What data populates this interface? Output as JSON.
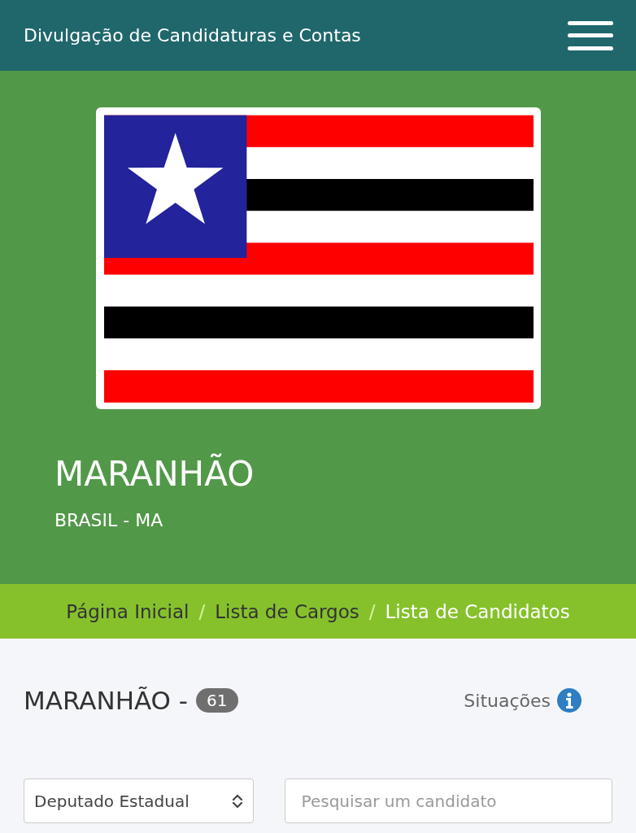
{
  "header": {
    "title": "Divulgação de Candidaturas e Contas"
  },
  "hero": {
    "kind": "flag",
    "title": "MARANHÃO",
    "subtitle": "BRASIL - MA"
  },
  "breadcrumb": {
    "separator": "/",
    "items": [
      {
        "label": "Página Inicial",
        "selected": false
      },
      {
        "label": "Lista de Cargos",
        "selected": false
      },
      {
        "label": "Lista de Candidatos",
        "selected": true
      }
    ]
  },
  "heading": {
    "title": "MARANHÃO -",
    "count": "61",
    "info_label": "Situações"
  },
  "filters": {
    "select": {
      "value": "Deputado Estadual"
    },
    "search": {
      "placeholder": "Pesquisar um candidato"
    }
  }
}
